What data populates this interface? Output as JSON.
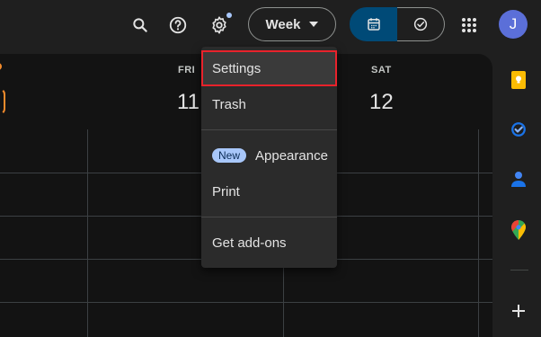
{
  "header": {
    "view_label": "Week",
    "avatar_initial": "J"
  },
  "calendar": {
    "days": [
      {
        "name": "FRI",
        "number": "11"
      },
      {
        "name": "SAT",
        "number": "12"
      }
    ]
  },
  "menu": {
    "items": [
      {
        "label": "Settings"
      },
      {
        "label": "Trash"
      },
      {
        "label": "Appearance",
        "badge": "New"
      },
      {
        "label": "Print"
      },
      {
        "label": "Get add-ons"
      }
    ]
  },
  "icons": {
    "search": "search-icon",
    "help": "help-icon",
    "settings": "gear-icon",
    "dropdown": "caret-down-icon",
    "calendar": "calendar-icon",
    "tasks": "task-check-icon",
    "apps": "apps-grid-icon",
    "keep": "keep-icon",
    "tasks_app": "tasks-icon",
    "contacts": "contacts-icon",
    "maps": "maps-icon",
    "add": "plus-icon"
  },
  "colors": {
    "accent": "#004a77",
    "highlight_border": "#e8222b",
    "badge": "#a8c7fa",
    "partial_day": "#f28b2c"
  }
}
